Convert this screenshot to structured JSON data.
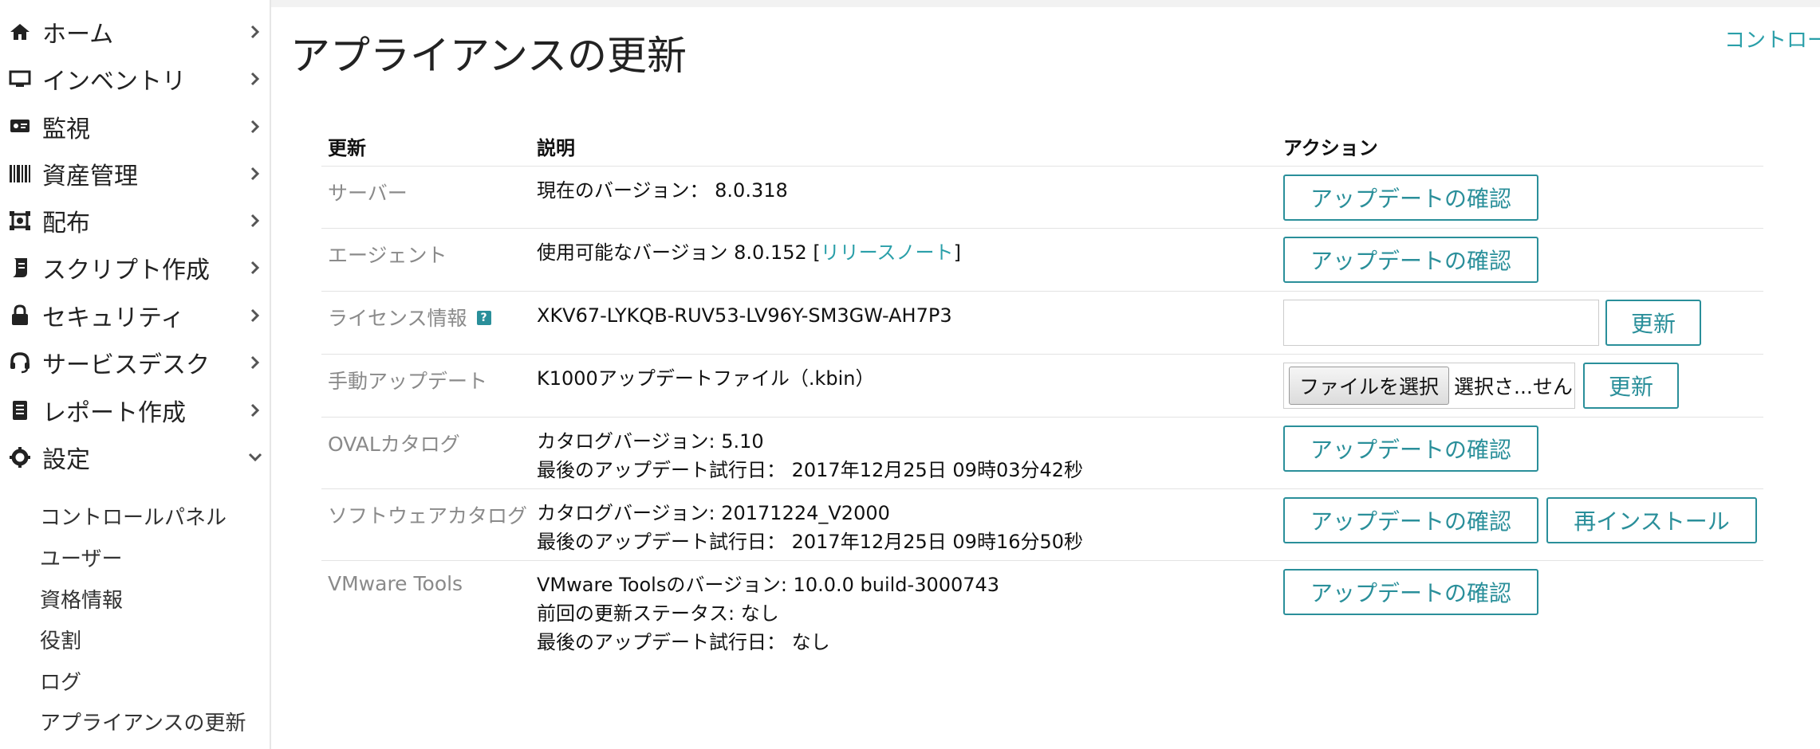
{
  "sidebar": {
    "items": [
      {
        "label": "ホーム",
        "icon": "home-icon"
      },
      {
        "label": "インベントリ",
        "icon": "monitor-icon"
      },
      {
        "label": "監視",
        "icon": "monitoring-icon"
      },
      {
        "label": "資産管理",
        "icon": "barcode-icon"
      },
      {
        "label": "配布",
        "icon": "distribution-icon"
      },
      {
        "label": "スクリプト作成",
        "icon": "script-icon"
      },
      {
        "label": "セキュリティ",
        "icon": "lock-icon"
      },
      {
        "label": "サービスデスク",
        "icon": "headset-icon"
      },
      {
        "label": "レポート作成",
        "icon": "report-icon"
      },
      {
        "label": "設定",
        "icon": "gear-icon"
      }
    ],
    "settings_sub": [
      "コントロールパネル",
      "ユーザー",
      "資格情報",
      "役割",
      "ログ",
      "アプライアンスの更新"
    ]
  },
  "header": {
    "title": "アプライアンスの更新",
    "control_panel_link": "コントロー"
  },
  "table": {
    "headers": {
      "update": "更新",
      "description": "説明",
      "action": "アクション"
    },
    "rows": {
      "server": {
        "name": "サーバー",
        "desc": "現在のバージョン： 8.0.318",
        "button": "アップデートの確認"
      },
      "agent": {
        "name": "エージェント",
        "desc_prefix": "使用可能なバージョン 8.0.152  [",
        "desc_link": "リリースノート",
        "desc_suffix": "]",
        "button": "アップデートの確認"
      },
      "license": {
        "name": "ライセンス情報",
        "help": "?",
        "desc": "XKV67-LYKQB-RUV53-LV96Y-SM3GW-AH7P3",
        "input_value": "",
        "button": "更新"
      },
      "manual": {
        "name": "手動アップデート",
        "desc": "K1000アップデートファイル（.kbin）",
        "file_button": "ファイルを選択",
        "file_text": "選択さ...せん",
        "button": "更新"
      },
      "oval": {
        "name": "OVALカタログ",
        "desc1": "カタログバージョン: 5.10",
        "desc2": "最後のアップデート試行日： 2017年12月25日 09時03分42秒",
        "button": "アップデートの確認"
      },
      "software": {
        "name": "ソフトウェアカタログ",
        "desc1": "カタログバージョン: 20171224_V2000",
        "desc2": "最後のアップデート試行日： 2017年12月25日 09時16分50秒",
        "button": "アップデートの確認",
        "button2": "再インストール"
      },
      "vmware": {
        "name": "VMware Tools",
        "desc1": "VMware Toolsのバージョン: 10.0.0 build-3000743",
        "desc2": "前回の更新ステータス: なし",
        "desc3": "最後のアップデート試行日： なし",
        "button": "アップデートの確認"
      }
    }
  },
  "colors": {
    "accent": "#2a8f9a",
    "link": "#2a9fa9",
    "muted": "#8a8a8a"
  }
}
